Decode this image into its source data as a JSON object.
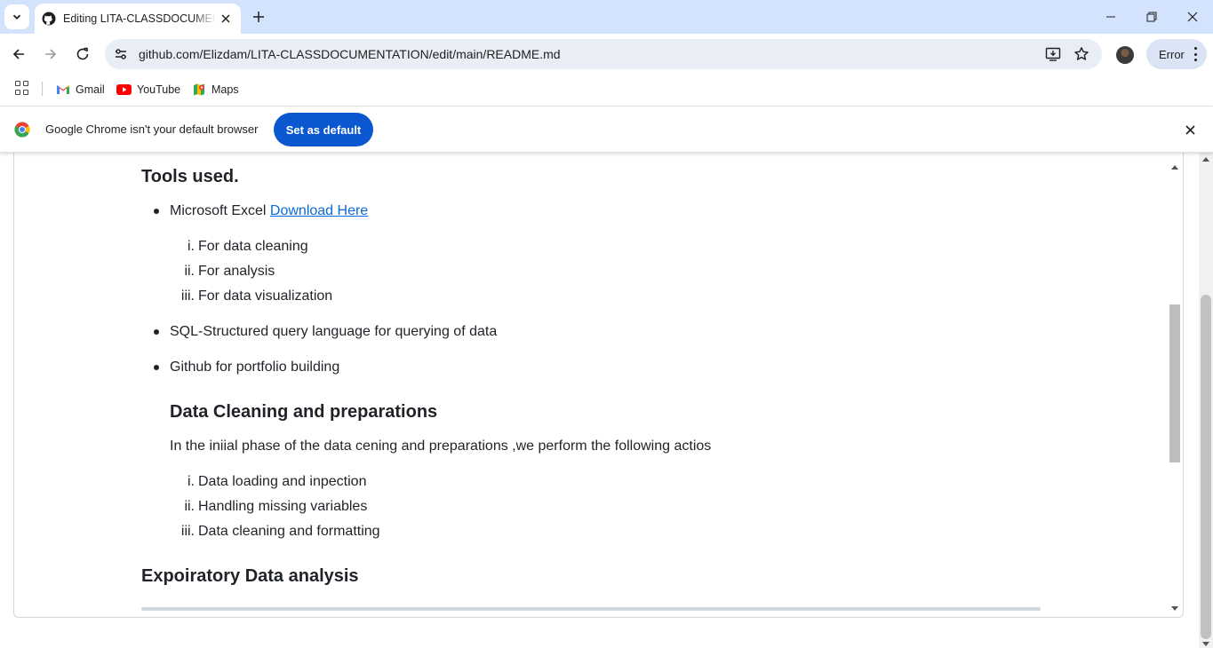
{
  "browser": {
    "tab": {
      "title": "Editing LITA-CLASSDOCUMENTATION/README.md"
    },
    "address_bar": {
      "url": "github.com/Elizdam/LITA-CLASSDOCUMENTATION/edit/main/README.md"
    },
    "profile_button": {
      "label": "Error"
    },
    "bookmarks": [
      {
        "label": "Gmail",
        "icon": "gmail-icon"
      },
      {
        "label": "YouTube",
        "icon": "youtube-icon"
      },
      {
        "label": "Maps",
        "icon": "maps-icon"
      }
    ],
    "infobar": {
      "message": "Google Chrome isn't your default browser",
      "button": "Set as default"
    }
  },
  "content": {
    "tools_heading": "Tools used.",
    "tools": {
      "excel": {
        "text": "Microsoft Excel ",
        "link": "Download Here"
      },
      "excel_uses": [
        {
          "num": "i.",
          "text": "For data cleaning"
        },
        {
          "num": "ii.",
          "text": "For analysis"
        },
        {
          "num": "iii.",
          "text": "For data visualization"
        }
      ],
      "sql": "SQL-Structured query language for querying of data",
      "github": "Github for portfolio building"
    },
    "cleaning_heading": "Data Cleaning and preparations",
    "cleaning_intro": "In the iniial phase of the data cening and preparations ,we perform the following actios",
    "cleaning_steps": [
      {
        "num": "i.",
        "text": "Data loading and inpection"
      },
      {
        "num": "ii.",
        "text": "Handling missing variables"
      },
      {
        "num": "iii.",
        "text": "Data cleaning and formatting"
      }
    ],
    "eda_heading": "Expoiratory Data analysis"
  },
  "colors": {
    "accent": "#0b57d0",
    "link": "#0969da",
    "tabstrip": "#d3e3fd"
  }
}
